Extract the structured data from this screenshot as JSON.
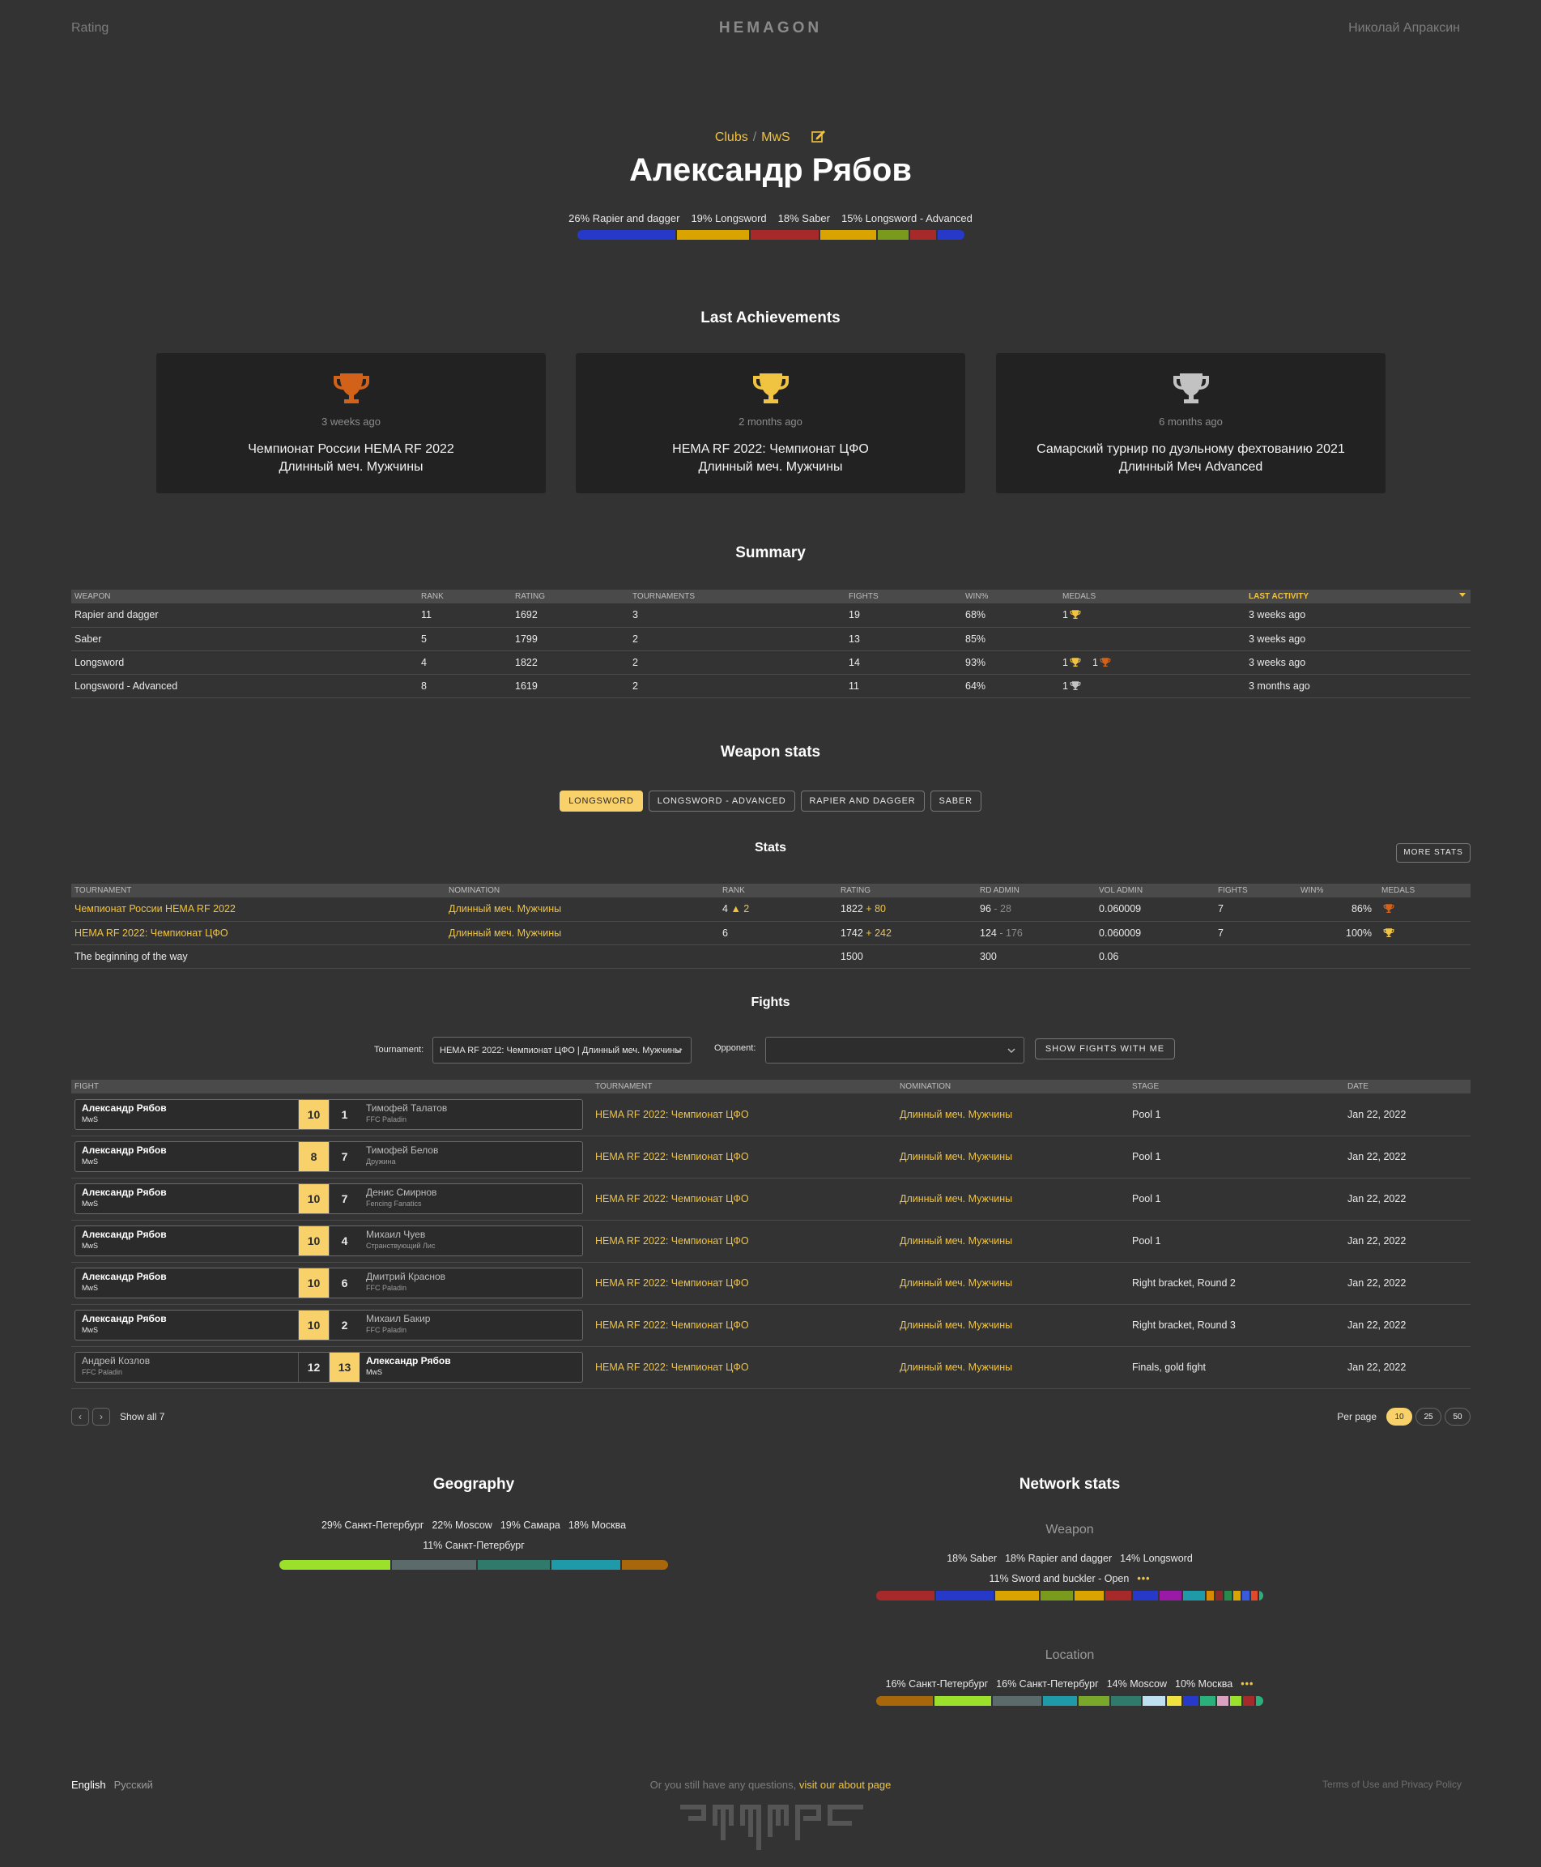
{
  "header": {
    "rating_link": "Rating",
    "logo": "HEMAGON",
    "user_name": "Николай Апраксин"
  },
  "profile": {
    "crumb_clubs": "Clubs",
    "crumb_sep": "/",
    "crumb_club": "MwS",
    "name": "Александр Рябов",
    "weapon_labels": [
      "26% Rapier and dagger",
      "19% Longsword",
      "18% Saber",
      "15% Longsword - Advanced"
    ],
    "weapon_bar": [
      {
        "pct": 26,
        "color": "#2639c9"
      },
      {
        "pct": 19,
        "color": "#d9a300"
      },
      {
        "pct": 18,
        "color": "#a62a2a"
      },
      {
        "pct": 15,
        "color": "#d9a300"
      },
      {
        "pct": 8,
        "color": "#7a9a1e"
      },
      {
        "pct": 7,
        "color": "#a62a2a"
      },
      {
        "pct": 7,
        "color": "#2639c9"
      }
    ]
  },
  "achievements": {
    "title": "Last Achievements",
    "items": [
      {
        "medal": "bronze",
        "color": "#d2621a",
        "ago": "3 weeks ago",
        "line1": "Чемпионат России HEMA RF 2022",
        "line2": "Длинный меч. Мужчины"
      },
      {
        "medal": "gold",
        "color": "#f0c340",
        "ago": "2 months ago",
        "line1": "HEMA RF 2022: Чемпионат ЦФО",
        "line2": "Длинный меч. Мужчины"
      },
      {
        "medal": "silver",
        "color": "#c2c2c2",
        "ago": "6 months ago",
        "line1": "Самарский турнир по дуэльному фехтованию 2021",
        "line2": "Длинный Меч Advanced"
      }
    ]
  },
  "summary": {
    "title": "Summary",
    "headers": [
      "Weapon",
      "Rank",
      "Rating",
      "Tournaments",
      "Fights",
      "Win%",
      "Medals",
      "Last activity"
    ],
    "rows": [
      {
        "weapon": "Rapier and dagger",
        "rank": "11",
        "rating": "1692",
        "tournaments": "3",
        "fights": "19",
        "win": "68%",
        "medals": [
          {
            "count": "1",
            "type": "gold"
          }
        ],
        "last": "3 weeks ago"
      },
      {
        "weapon": "Saber",
        "rank": "5",
        "rating": "1799",
        "tournaments": "2",
        "fights": "13",
        "win": "85%",
        "medals": [],
        "last": "3 weeks ago"
      },
      {
        "weapon": "Longsword",
        "rank": "4",
        "rating": "1822",
        "tournaments": "2",
        "fights": "14",
        "win": "93%",
        "medals": [
          {
            "count": "1",
            "type": "gold"
          },
          {
            "count": "1",
            "type": "bronze"
          }
        ],
        "last": "3 weeks ago"
      },
      {
        "weapon": "Longsword - Advanced",
        "rank": "8",
        "rating": "1619",
        "tournaments": "2",
        "fights": "11",
        "win": "64%",
        "medals": [
          {
            "count": "1",
            "type": "silver"
          }
        ],
        "last": "3 months ago"
      }
    ]
  },
  "weapon_stats": {
    "title": "Weapon stats",
    "tabs": [
      "LONGSWORD",
      "LONGSWORD - ADVANCED",
      "RAPIER AND DAGGER",
      "SABER"
    ],
    "active_tab": 0,
    "stats_title": "Stats",
    "more_stats": "MORE STATS",
    "headers": [
      "Tournament",
      "Nomination",
      "Rank",
      "Rating",
      "RD Admin",
      "Vol Admin",
      "Fights",
      "Win%",
      "Medals"
    ],
    "rows": [
      {
        "tournament": "Чемпионат России HEMA RF 2022",
        "nomination": "Длинный меч. Мужчины",
        "rank": "4",
        "rank_delta": "▲ 2",
        "rating": "1822",
        "rating_delta": "+ 80",
        "rd": "96",
        "rd_delta": "- 28",
        "vol": "0.060009",
        "fights": "7",
        "win": "86%",
        "medal": "bronze"
      },
      {
        "tournament": "HEMA RF 2022: Чемпионат ЦФО",
        "nomination": "Длинный меч. Мужчины",
        "rank": "6",
        "rank_delta": "",
        "rating": "1742",
        "rating_delta": "+ 242",
        "rd": "124",
        "rd_delta": "- 176",
        "vol": "0.060009",
        "fights": "7",
        "win": "100%",
        "medal": "gold"
      },
      {
        "tournament": "The beginning of the way",
        "nomination": "",
        "rank": "",
        "rank_delta": "",
        "rating": "1500",
        "rating_delta": "",
        "rd": "300",
        "rd_delta": "",
        "vol": "0.06",
        "fights": "",
        "win": "",
        "medal": ""
      }
    ]
  },
  "fights": {
    "title": "Fights",
    "tournament_label": "Tournament:",
    "tournament_value": "HEMA RF 2022: Чемпионат ЦФО | Длинный меч. Мужчины",
    "opponent_label": "Opponent:",
    "opponent_value": "",
    "show_btn": "SHOW FIGHTS WITH ME",
    "headers": [
      "Fight",
      "Tournament",
      "Nomination",
      "Stage",
      "Date"
    ],
    "rows": [
      {
        "left_name": "Александр Рябов",
        "left_club": "MwS",
        "left_score": "10",
        "right_score": "1",
        "right_name": "Тимофей Талатов",
        "right_club": "FFC Paladin",
        "winner": "left",
        "tournament": "HEMA RF 2022: Чемпионат ЦФО",
        "nomination": "Длинный меч. Мужчины",
        "stage": "Pool 1",
        "date": "Jan 22, 2022"
      },
      {
        "left_name": "Александр Рябов",
        "left_club": "MwS",
        "left_score": "8",
        "right_score": "7",
        "right_name": "Тимофей Белов",
        "right_club": "Дружина",
        "winner": "left",
        "tournament": "HEMA RF 2022: Чемпионат ЦФО",
        "nomination": "Длинный меч. Мужчины",
        "stage": "Pool 1",
        "date": "Jan 22, 2022"
      },
      {
        "left_name": "Александр Рябов",
        "left_club": "MwS",
        "left_score": "10",
        "right_score": "7",
        "right_name": "Денис Смирнов",
        "right_club": "Fencing Fanatics",
        "winner": "left",
        "tournament": "HEMA RF 2022: Чемпионат ЦФО",
        "nomination": "Длинный меч. Мужчины",
        "stage": "Pool 1",
        "date": "Jan 22, 2022"
      },
      {
        "left_name": "Александр Рябов",
        "left_club": "MwS",
        "left_score": "10",
        "right_score": "4",
        "right_name": "Михаил Чуев",
        "right_club": "Странствующий Лис",
        "winner": "left",
        "tournament": "HEMA RF 2022: Чемпионат ЦФО",
        "nomination": "Длинный меч. Мужчины",
        "stage": "Pool 1",
        "date": "Jan 22, 2022"
      },
      {
        "left_name": "Александр Рябов",
        "left_club": "MwS",
        "left_score": "10",
        "right_score": "6",
        "right_name": "Дмитрий Краснов",
        "right_club": "FFC Paladin",
        "winner": "left",
        "tournament": "HEMA RF 2022: Чемпионат ЦФО",
        "nomination": "Длинный меч. Мужчины",
        "stage": "Right bracket, Round 2",
        "date": "Jan 22, 2022"
      },
      {
        "left_name": "Александр Рябов",
        "left_club": "MwS",
        "left_score": "10",
        "right_score": "2",
        "right_name": "Михаил Бакир",
        "right_club": "FFC Paladin",
        "winner": "left",
        "tournament": "HEMA RF 2022: Чемпионат ЦФО",
        "nomination": "Длинный меч. Мужчины",
        "stage": "Right bracket, Round 3",
        "date": "Jan 22, 2022"
      },
      {
        "left_name": "Андрей Козлов",
        "left_club": "FFC Paladin",
        "left_score": "12",
        "right_score": "13",
        "right_name": "Александр Рябов",
        "right_club": "MwS",
        "winner": "right",
        "tournament": "HEMA RF 2022: Чемпионат ЦФО",
        "nomination": "Длинный меч. Мужчины",
        "stage": "Finals, gold fight",
        "date": "Jan 22, 2022"
      }
    ],
    "show_all": "Show all 7",
    "per_page_label": "Per page",
    "per_page_options": [
      "10",
      "25",
      "50"
    ],
    "per_page_active": 0
  },
  "geography": {
    "title": "Geography",
    "labels": [
      "29% Санкт-Петербург",
      "22% Moscow",
      "19% Самара",
      "18% Москва"
    ],
    "labels2": [
      "11% Санкт-Петербург"
    ],
    "bar": [
      {
        "pct": 29,
        "color": "#9be02a"
      },
      {
        "pct": 22,
        "color": "#5b6a6a"
      },
      {
        "pct": 19,
        "color": "#2f7a6a"
      },
      {
        "pct": 18,
        "color": "#1f9aa8"
      },
      {
        "pct": 12,
        "color": "#a8670a"
      }
    ]
  },
  "network": {
    "title": "Network stats",
    "weapon_sub": "Weapon",
    "weapon_labels": [
      "18% Saber",
      "18% Rapier and dagger",
      "14% Longsword"
    ],
    "weapon_labels2": [
      "11% Sword and buckler - Open"
    ],
    "weapon_bar": [
      {
        "pct": 16,
        "color": "#a62a2a"
      },
      {
        "pct": 16,
        "color": "#2639c9"
      },
      {
        "pct": 12,
        "color": "#d9a300"
      },
      {
        "pct": 9,
        "color": "#7a9a1e"
      },
      {
        "pct": 8,
        "color": "#d9a300"
      },
      {
        "pct": 7,
        "color": "#a62a2a"
      },
      {
        "pct": 7,
        "color": "#2639c9"
      },
      {
        "pct": 6,
        "color": "#9a1aa8"
      },
      {
        "pct": 6,
        "color": "#1f9aa8"
      },
      {
        "pct": 2,
        "color": "#d98a00"
      },
      {
        "pct": 2,
        "color": "#8a2a2a"
      },
      {
        "pct": 2,
        "color": "#2a8a4a"
      },
      {
        "pct": 2,
        "color": "#d9a300"
      },
      {
        "pct": 2,
        "color": "#3a5ad9"
      },
      {
        "pct": 2,
        "color": "#e04a2a"
      },
      {
        "pct": 1,
        "color": "#2ab07a"
      }
    ],
    "location_sub": "Location",
    "location_labels": [
      "16% Санкт-Петербург",
      "16% Санкт-Петербург",
      "14% Moscow",
      "10% Москва"
    ],
    "location_bar": [
      {
        "pct": 15,
        "color": "#a8670a"
      },
      {
        "pct": 15,
        "color": "#9be02a"
      },
      {
        "pct": 13,
        "color": "#5b6a6a"
      },
      {
        "pct": 9,
        "color": "#1f9aa8"
      },
      {
        "pct": 8,
        "color": "#7aa82a"
      },
      {
        "pct": 8,
        "color": "#2f7a6a"
      },
      {
        "pct": 6,
        "color": "#bfe0f0"
      },
      {
        "pct": 4,
        "color": "#f0e040"
      },
      {
        "pct": 4,
        "color": "#2639c9"
      },
      {
        "pct": 4,
        "color": "#2ab07a"
      },
      {
        "pct": 3,
        "color": "#d9a0c0"
      },
      {
        "pct": 3,
        "color": "#9be02a"
      },
      {
        "pct": 3,
        "color": "#a62a2a"
      },
      {
        "pct": 2,
        "color": "#2ab07a"
      }
    ]
  },
  "footer": {
    "lang_active": "English",
    "lang_other": "Русский",
    "question": "Or you still have any questions,",
    "about_link": "visit our about page",
    "terms": "Terms of Use and Privacy Policy",
    "logo_text": "ЪЦЈЦЇБ"
  },
  "colors": {
    "accent": "#f0c340",
    "accent_btn": "#f9d16b",
    "background": "#333333",
    "card": "#222222"
  }
}
